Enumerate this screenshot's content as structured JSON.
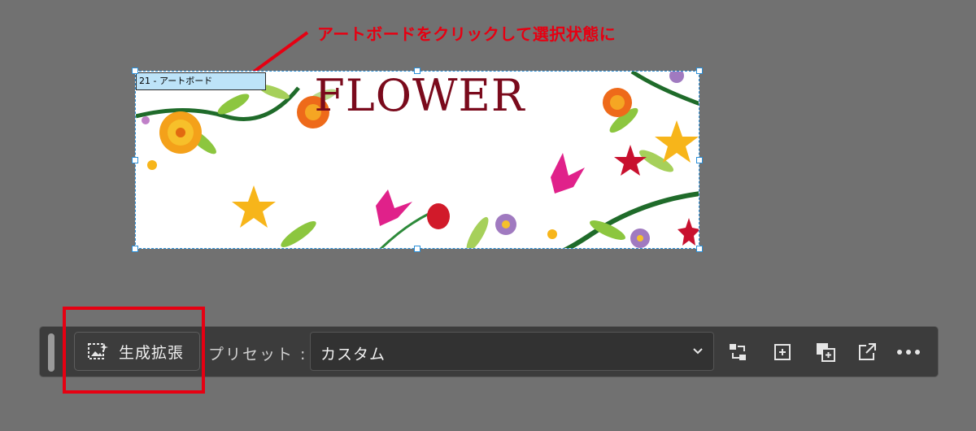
{
  "annotation": {
    "text": "アートボードをクリックして選択状態に"
  },
  "artboard": {
    "label": "21 - アートボード",
    "title": "FLOWER"
  },
  "toolbar": {
    "generate_label": "生成拡張",
    "preset_label": "プリセット :",
    "preset_value": "カスタム",
    "icons": [
      "swap-icon",
      "add-square-icon",
      "duplicate-icon",
      "external-link-icon",
      "more-icon"
    ]
  },
  "colors": {
    "annotation_red": "#e60012",
    "selection_blue": "#2a8fd8",
    "title_maroon": "#7a0a1c"
  }
}
